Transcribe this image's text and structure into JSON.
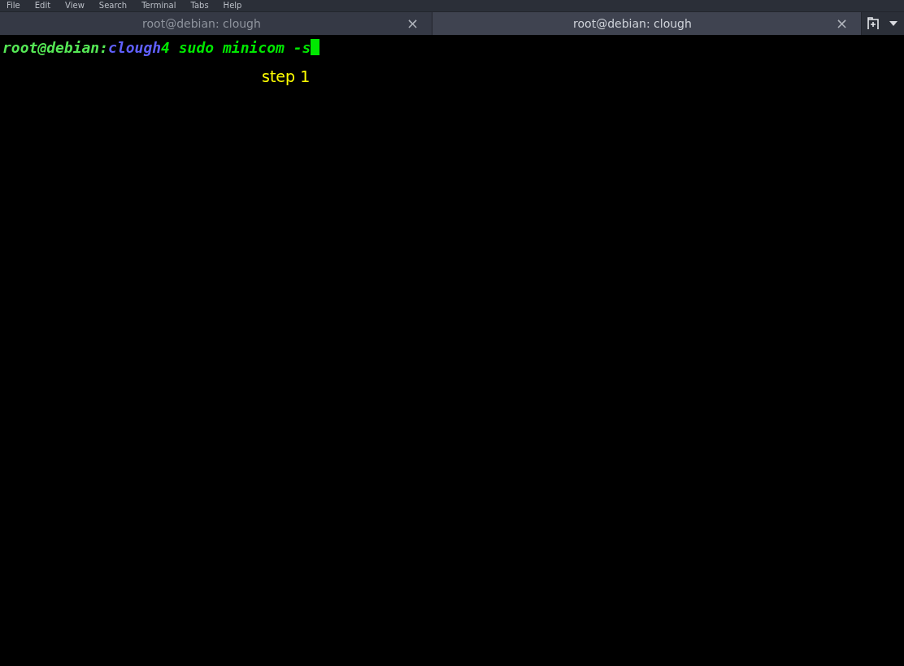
{
  "menu": [
    "File",
    "Edit",
    "View",
    "Search",
    "Terminal",
    "Tabs",
    "Help"
  ],
  "tabs": [
    {
      "title": "root@debian: clough",
      "close": "×",
      "selected": false
    },
    {
      "title": "root@debian: clough",
      "close": "×",
      "selected": true
    }
  ],
  "terminal": {
    "prompt": [
      {
        "text": "root@debian",
        "color": "#55e855"
      },
      {
        "text": ":",
        "color": "#55e855"
      },
      {
        "text": "clough",
        "color": "#6060ff"
      },
      {
        "text": "4 sudo minicom -s",
        "color": "#00e800"
      }
    ],
    "cursor": true,
    "annotation": "step 1"
  }
}
